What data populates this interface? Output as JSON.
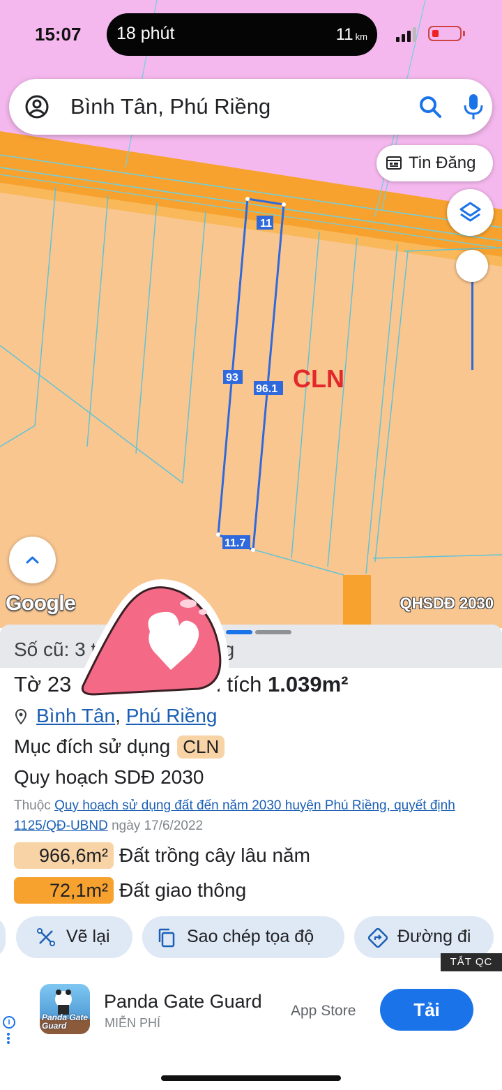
{
  "status_bar": {
    "time": "15:07",
    "island_left": "18 phút",
    "island_right": "11",
    "island_unit": "km"
  },
  "search": {
    "query": "Bình Tân, Phú Riềng"
  },
  "map": {
    "tin_dang_label": "Tin Đăng",
    "cln_label": "CLN",
    "edge_labels": [
      "11",
      "93",
      "96.1",
      "11.7"
    ],
    "google_label": "Google",
    "layer_label": "QHSDĐ 2030",
    "colors": {
      "land": "#f9c690",
      "road": "#f7a22f",
      "residential": "#f5b8ee",
      "boundary": "#2f69dc",
      "parcel_lines": "#5fc3d8"
    }
  },
  "sheet": {
    "old_ref": "Số cũ: 3 thửa Long Hưng",
    "sheet_prefix": "Tờ 23",
    "area_prefix": "ện tích ",
    "area_value": "1.039m²",
    "location": {
      "ward": "Bình Tân",
      "district": "Phú Riềng"
    },
    "usage_label": "Mục đích sử dụng",
    "usage_code": "CLN",
    "plan_title": "Quy hoạch SDĐ 2030",
    "plan_source_prefix": "Thuộc",
    "plan_source_link": "Quy hoạch sử dụng đất đến năm 2030 huyện Phú Riềng, quyết định 1125/QĐ-UBND",
    "plan_source_suffix": "ngày 17/6/2022",
    "areas": [
      {
        "value": "966,6m²",
        "label": "Đất trồng cây lâu năm",
        "color": "#f8d3a6"
      },
      {
        "value": "72,1m²",
        "label": "Đất giao thông",
        "color": "#f7a22f"
      }
    ],
    "actions": [
      "Vẽ lại",
      "Sao chép tọa độ",
      "Đường đi"
    ]
  },
  "ad": {
    "close_label": "TẮT QC",
    "app_name": "Panda Gate Guard",
    "price": "MIỄN PHÍ",
    "store": "App Store",
    "cta": "Tải",
    "icon_text": "Panda Gate Guard"
  }
}
